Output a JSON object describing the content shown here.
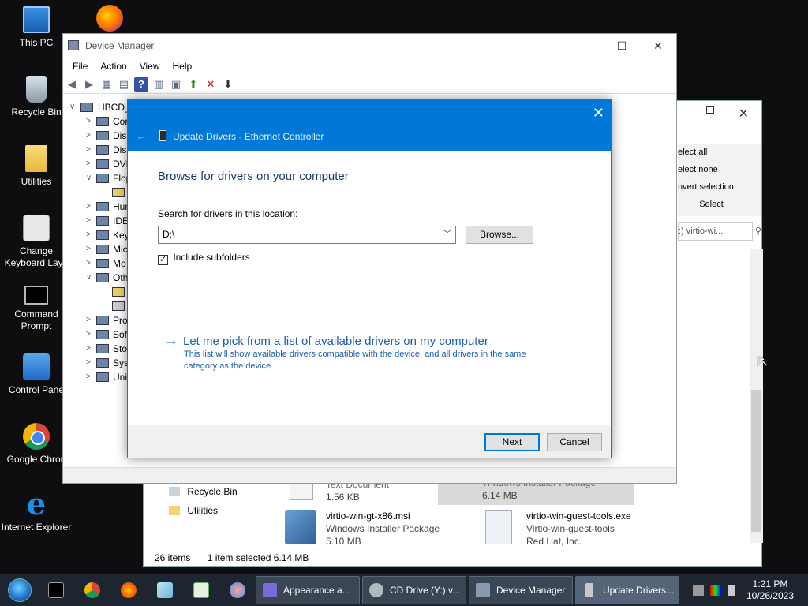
{
  "desktop": {
    "icons": [
      {
        "label": "This PC",
        "icon": "computer-icon"
      },
      {
        "label": "",
        "icon": "firefox-icon"
      },
      {
        "label": "Recycle Bin",
        "icon": "recycle-bin-icon"
      },
      {
        "label": "Utilities",
        "icon": "folder-icon"
      },
      {
        "label": "Change Keyboard Layo",
        "icon": "keyboard-icon"
      },
      {
        "label": "Command Prompt",
        "icon": "command-prompt-icon"
      },
      {
        "label": "Control Pane",
        "icon": "control-panel-icon"
      },
      {
        "label": "Google Chron",
        "icon": "chrome-icon"
      },
      {
        "label": "Internet Explorer",
        "icon": "internet-explorer-icon"
      }
    ]
  },
  "explorer": {
    "ribbon": [
      "elect all",
      "elect none",
      "nvert selection",
      "Select"
    ],
    "search_placeholder": ":) virtio-wi...",
    "nav_items": [
      "Recycle Bin",
      "Utilities"
    ],
    "files": [
      {
        "name": "Text Document",
        "type": "1.56 KB",
        "size": ""
      },
      {
        "name": "Windows Installer Package",
        "type": "6.14 MB",
        "size": ""
      },
      {
        "name": "virtio-win-gt-x86.msi",
        "type": "Windows Installer Package",
        "size": "5.10 MB"
      },
      {
        "name": "virtio-win-guest-tools.exe",
        "type": "Virtio-win-guest-tools",
        "size": "Red Hat, Inc."
      }
    ],
    "status": {
      "items": "26 items",
      "selected": "1 item selected  6.14 MB"
    },
    "close_label": "✕"
  },
  "device_manager": {
    "title": "Device Manager",
    "window_buttons": {
      "minimize": "—",
      "maximize": "☐",
      "close": "✕"
    },
    "menu": [
      "File",
      "Action",
      "View",
      "Help"
    ],
    "tree": [
      {
        "label": "HBCD_",
        "expander": "∨",
        "level": "root"
      },
      {
        "label": "Cor",
        "expander": ">",
        "level": "cat"
      },
      {
        "label": "Disl",
        "expander": ">",
        "level": "cat"
      },
      {
        "label": "Disp",
        "expander": ">",
        "level": "cat"
      },
      {
        "label": "DVD",
        "expander": ">",
        "level": "cat"
      },
      {
        "label": "Flop",
        "expander": "∨",
        "level": "cat"
      },
      {
        "label": "",
        "expander": "",
        "level": "child"
      },
      {
        "label": "Hun",
        "expander": ">",
        "level": "cat"
      },
      {
        "label": "IDE",
        "expander": ">",
        "level": "cat"
      },
      {
        "label": "Key",
        "expander": ">",
        "level": "cat"
      },
      {
        "label": "Mic",
        "expander": ">",
        "level": "cat"
      },
      {
        "label": "Mo",
        "expander": ">",
        "level": "cat"
      },
      {
        "label": "Oth",
        "expander": "∨",
        "level": "cat"
      },
      {
        "label": "",
        "expander": "",
        "level": "child"
      },
      {
        "label": "",
        "expander": "",
        "level": "child"
      },
      {
        "label": "Pro",
        "expander": ">",
        "level": "cat"
      },
      {
        "label": "Sof",
        "expander": ">",
        "level": "cat"
      },
      {
        "label": "Sto",
        "expander": ">",
        "level": "cat"
      },
      {
        "label": "Sys",
        "expander": ">",
        "level": "cat"
      },
      {
        "label": "Uni",
        "expander": ">",
        "level": "cat"
      }
    ]
  },
  "dialog": {
    "title": "Update Drivers - Ethernet Controller",
    "close_label": "✕",
    "back_label": "←",
    "heading": "Browse for drivers on your computer",
    "search_label": "Search for drivers in this location:",
    "path_value": "D:\\",
    "browse_label": "Browse...",
    "include_subfolders_label": "Include subfolders",
    "include_subfolders_checked": "✓",
    "pick_link": "Let me pick from a list of available drivers on my computer",
    "pick_description": "This list will show available drivers compatible with the device, and all drivers in the same category as the device.",
    "next_label": "Next",
    "cancel_label": "Cancel"
  },
  "taskbar": {
    "tasks": [
      {
        "label": "Appearance a...",
        "icon": "appearance-icon"
      },
      {
        "label": "CD Drive (Y:) v...",
        "icon": "cd-drive-icon"
      },
      {
        "label": "Device Manager",
        "icon": "device-manager-icon"
      },
      {
        "label": "Update Drivers...",
        "icon": "update-drivers-icon"
      }
    ],
    "time": "1:21 PM",
    "date": "10/26/2023"
  }
}
